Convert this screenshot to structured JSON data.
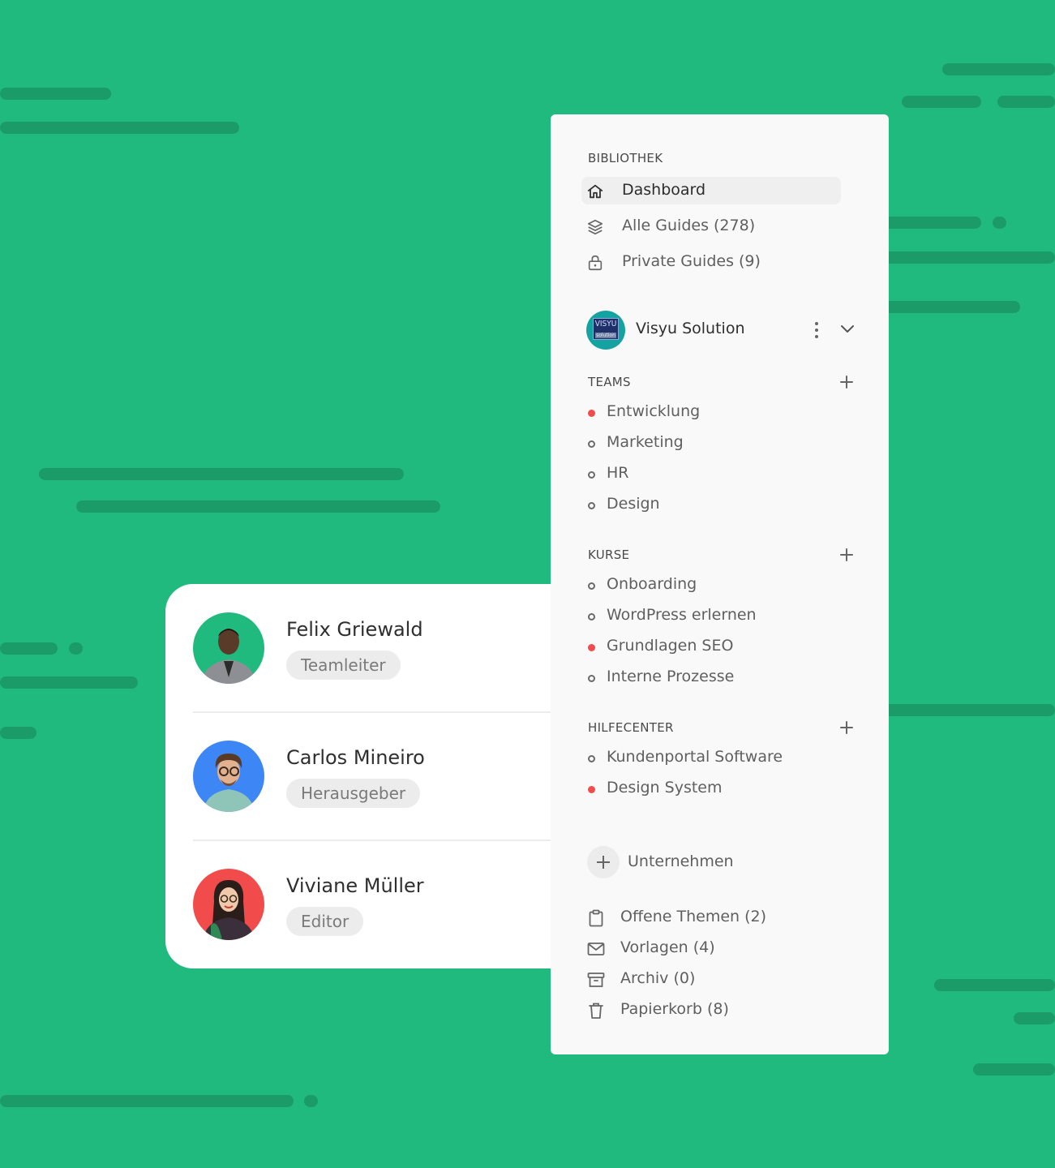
{
  "colors": {
    "background": "#21ba7e",
    "stripe": "#1b9b68",
    "dot_active": "#f24b4b",
    "card": "#ffffff",
    "sidebar": "#f9f9f9"
  },
  "users": [
    {
      "name": "Felix Griewald",
      "role": "Teamleiter",
      "avatar_bg": "#21ba7e"
    },
    {
      "name": "Carlos Mineiro",
      "role": "Herausgeber",
      "avatar_bg": "#3d86f5"
    },
    {
      "name": "Viviane Müller",
      "role": "Editor",
      "avatar_bg": "#f24b4b"
    }
  ],
  "sidebar": {
    "library": {
      "heading": "BIBLIOTHEK",
      "items": [
        {
          "label": "Dashboard",
          "icon": "home-icon",
          "active": true
        },
        {
          "label": "Alle Guides (278)",
          "icon": "layers-icon",
          "active": false
        },
        {
          "label": "Private Guides (9)",
          "icon": "lock-icon",
          "active": false
        }
      ]
    },
    "organization": {
      "name": "Visyu Solution",
      "logo_text": "VISYU",
      "logo_subtext": "solution"
    },
    "teams": {
      "heading": "TEAMS",
      "items": [
        {
          "label": "Entwicklung",
          "active": true
        },
        {
          "label": "Marketing",
          "active": false
        },
        {
          "label": "HR",
          "active": false
        },
        {
          "label": "Design",
          "active": false
        }
      ]
    },
    "courses": {
      "heading": "KURSE",
      "items": [
        {
          "label": "Onboarding",
          "active": false
        },
        {
          "label": "WordPress erlernen",
          "active": false
        },
        {
          "label": "Grundlagen SEO",
          "active": true
        },
        {
          "label": "Interne Prozesse",
          "active": false
        }
      ]
    },
    "helpcenter": {
      "heading": "HILFECENTER",
      "items": [
        {
          "label": "Kundenportal Software",
          "active": false
        },
        {
          "label": "Design System",
          "active": true
        }
      ]
    },
    "add_company_label": "Unternehmen",
    "footer": [
      {
        "label": "Offene Themen (2)",
        "icon": "clipboard-icon"
      },
      {
        "label": "Vorlagen (4)",
        "icon": "mail-icon"
      },
      {
        "label": "Archiv (0)",
        "icon": "archive-icon"
      },
      {
        "label": "Papierkorb (8)",
        "icon": "trash-icon"
      }
    ]
  }
}
